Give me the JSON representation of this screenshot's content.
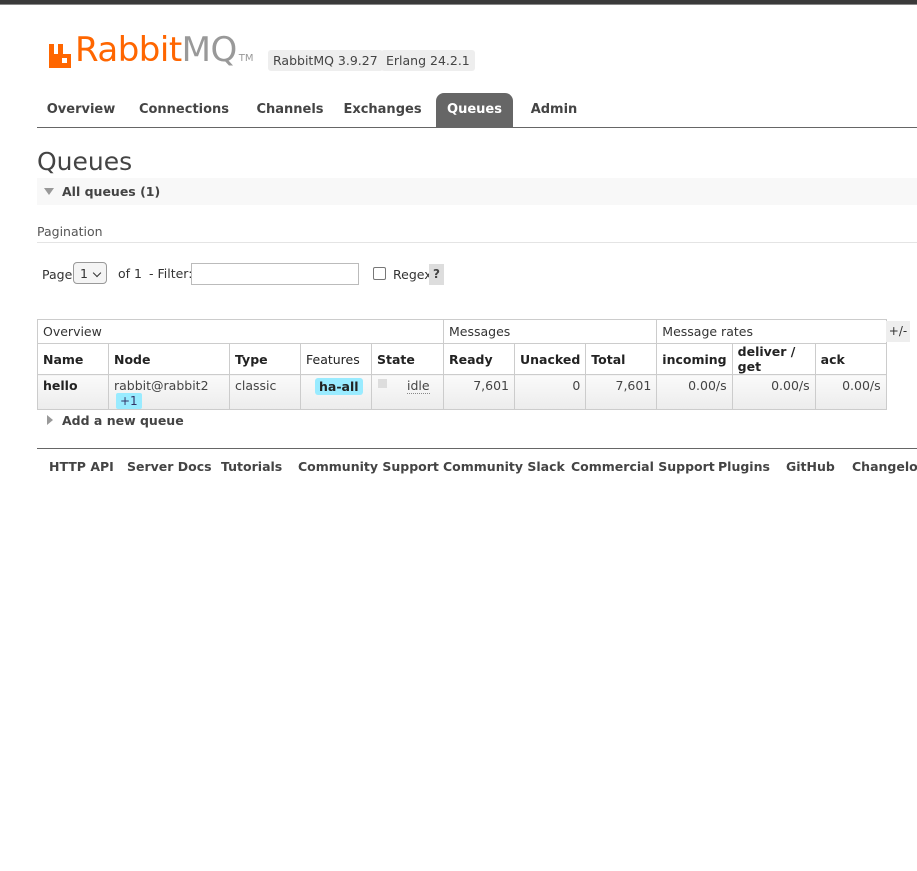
{
  "brand": {
    "name_left": "Rabbit",
    "name_right": "MQ",
    "tm": "TM",
    "brand_color": "#ff6600"
  },
  "versions": {
    "rabbitmq": "RabbitMQ 3.9.27",
    "erlang": "Erlang 24.2.1"
  },
  "nav": {
    "tabs": [
      {
        "label": "Overview"
      },
      {
        "label": "Connections"
      },
      {
        "label": "Channels"
      },
      {
        "label": "Exchanges"
      },
      {
        "label": "Queues",
        "active": true
      },
      {
        "label": "Admin"
      }
    ]
  },
  "page": {
    "title": "Queues",
    "section_title": "All queues (1)"
  },
  "pagination": {
    "label": "Pagination",
    "page_label": "Page",
    "page_value": "1",
    "of_label": "of 1",
    "filter_label": "- Filter:",
    "filter_value": "",
    "regex_label": "Regex",
    "regex_checked": false,
    "help_label": "?"
  },
  "table": {
    "groups": [
      "Overview",
      "Messages",
      "Message rates"
    ],
    "columns": [
      "Name",
      "Node",
      "Type",
      "Features",
      "State",
      "Ready",
      "Unacked",
      "Total",
      "incoming",
      "deliver / get",
      "ack"
    ],
    "toggle_label": "+/-",
    "rows": [
      {
        "name": "hello",
        "node": "rabbit@rabbit2",
        "node_extra": "+1",
        "type": "classic",
        "features": "ha-all",
        "state": "idle",
        "ready": "7,601",
        "unacked": "0",
        "total": "7,601",
        "incoming": "0.00/s",
        "deliver_get": "0.00/s",
        "ack": "0.00/s"
      }
    ]
  },
  "add_queue": {
    "label": "Add a new queue"
  },
  "footer": {
    "links": [
      "HTTP API",
      "Server Docs",
      "Tutorials",
      "Community Support",
      "Community Slack",
      "Commercial Support",
      "Plugins",
      "GitHub",
      "Changelog"
    ]
  }
}
